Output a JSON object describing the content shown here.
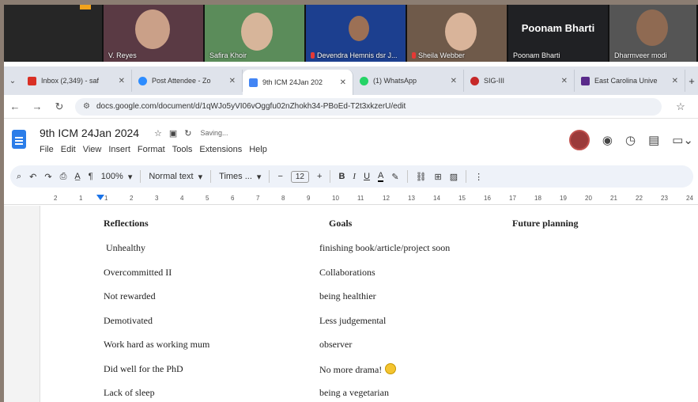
{
  "video_call": {
    "participants": [
      {
        "name": "V. Reyes"
      },
      {
        "name": "Safira Khoir"
      },
      {
        "name": "Devendra Hemnis dsr J..."
      },
      {
        "name": "Sheila Webber"
      },
      {
        "name": "Poonam Bharti",
        "display_name": "Poonam Bharti"
      },
      {
        "name": "Dharmveer modi"
      }
    ]
  },
  "browser": {
    "tabs": [
      {
        "title": "Inbox (2,349) - saf",
        "favicon_color": "#d93025"
      },
      {
        "title": "Post Attendee - Zo",
        "favicon_color": "#2d8cff"
      },
      {
        "title": "9th ICM 24Jan 202",
        "favicon_color": "#4285f4",
        "active": true
      },
      {
        "title": "(1) WhatsApp",
        "favicon_color": "#25d366"
      },
      {
        "title": "SIG-III",
        "favicon_color": "#c62828"
      },
      {
        "title": "East Carolina Unive",
        "favicon_color": "#592a8a"
      }
    ],
    "url": "docs.google.com/document/d/1qWJo5yVI06vOggfu02nZhokh34-PBoEd-T2t3xkzerU/edit"
  },
  "docs": {
    "title": "9th ICM 24Jan 2024",
    "saving": "Saving...",
    "menu": [
      "File",
      "Edit",
      "View",
      "Insert",
      "Format",
      "Tools",
      "Extensions",
      "Help"
    ],
    "toolbar": {
      "zoom": "100%",
      "style": "Normal text",
      "font": "Times ...",
      "font_size": "12"
    },
    "ruler_numbers": [
      "2",
      "1",
      "1",
      "2",
      "3",
      "4",
      "5",
      "6",
      "7",
      "8",
      "9",
      "10",
      "11",
      "12",
      "13",
      "14",
      "15",
      "16",
      "17",
      "18",
      "19",
      "20",
      "21",
      "22",
      "23",
      "24"
    ]
  },
  "table": {
    "headers": [
      "Reflections",
      "Goals",
      "Future planning"
    ],
    "rows": [
      [
        "Unhealthy",
        "finishing book/article/project soon",
        ""
      ],
      [
        "Overcommitted II",
        "Collaborations",
        ""
      ],
      [
        "Not rewarded",
        "being healthier",
        ""
      ],
      [
        "Demotivated",
        "Less judgemental",
        ""
      ],
      [
        "Work hard as working mum",
        "observer",
        ""
      ],
      [
        "Did well for the PhD",
        "No more drama!",
        ""
      ],
      [
        "Lack of sleep",
        "being a vegetarian",
        ""
      ]
    ]
  }
}
